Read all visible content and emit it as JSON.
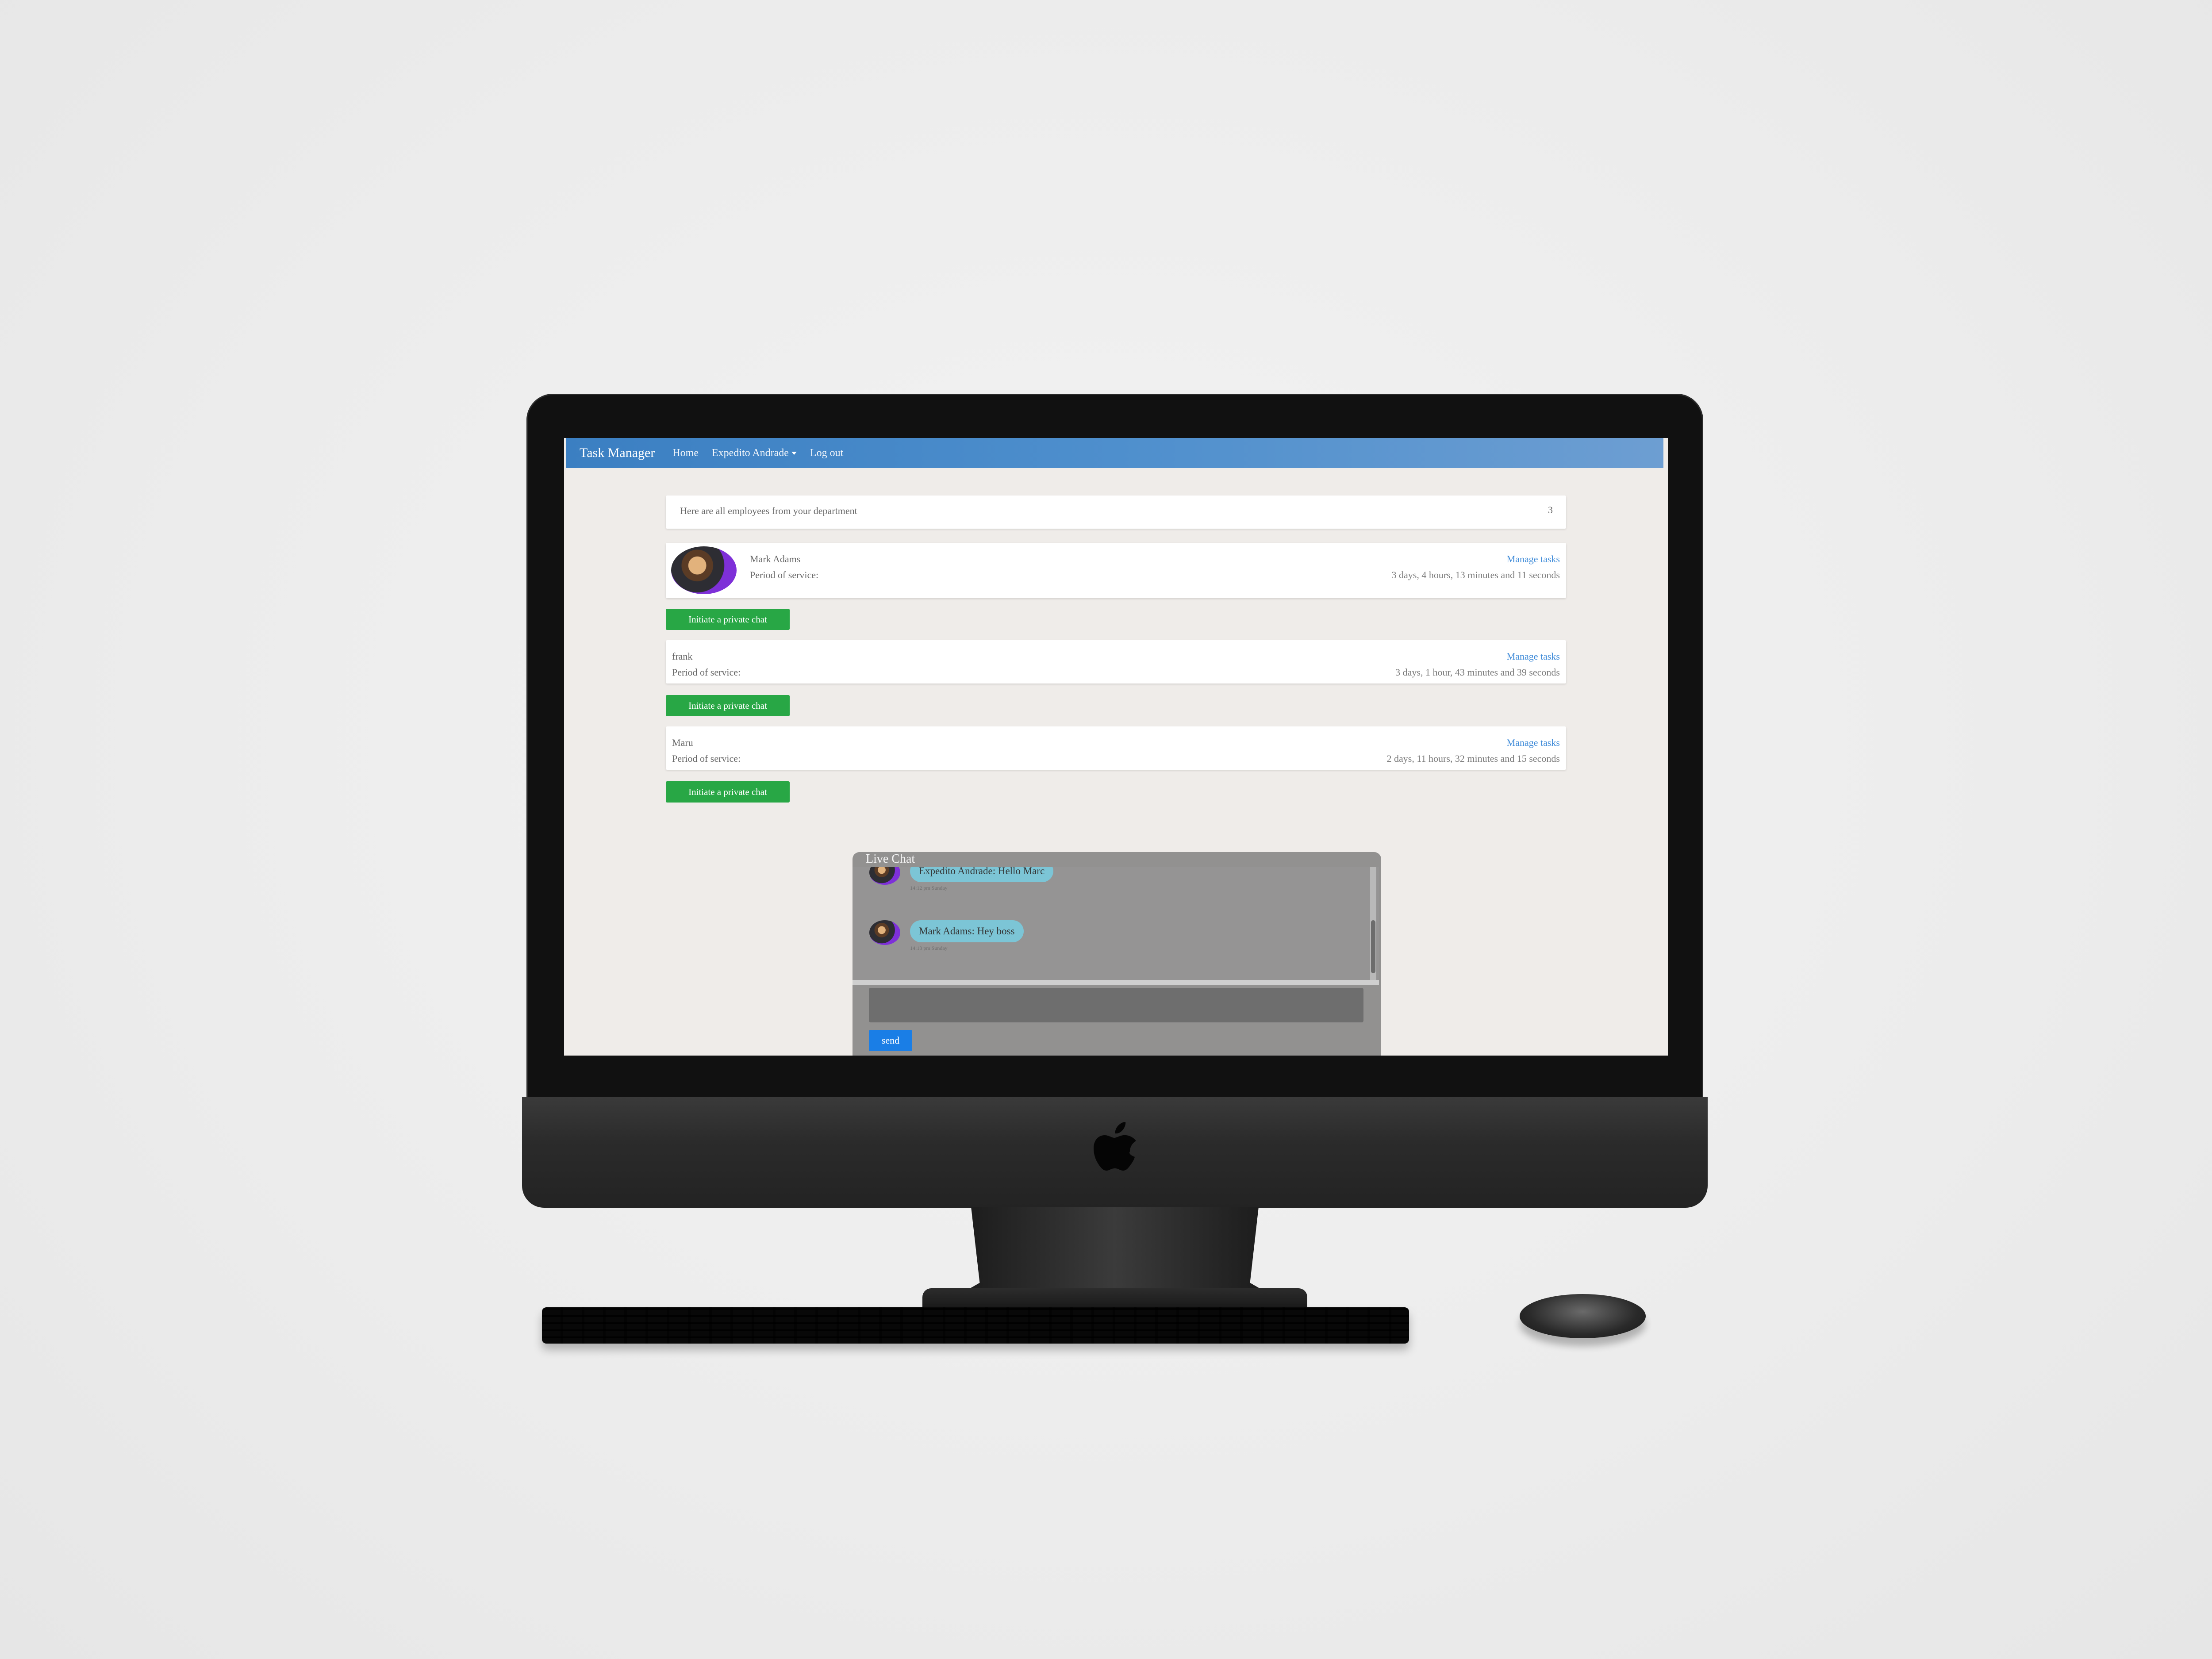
{
  "navbar": {
    "brand": "Task Manager",
    "home": "Home",
    "user": "Expedito Andrade",
    "logout": "Log out"
  },
  "department": {
    "heading": "Here are all employees from your department",
    "count": "3"
  },
  "employees": [
    {
      "name": "Mark Adams",
      "period_label": "Period of service:",
      "period": "3 days, 4 hours, 13 minutes and 11 seconds",
      "manage": "Manage tasks",
      "chat_button": "Initiate a private chat"
    },
    {
      "name": "frank",
      "period_label": "Period of service:",
      "period": "3 days, 1 hour, 43 minutes and 39 seconds",
      "manage": "Manage tasks",
      "chat_button": "Initiate a private chat"
    },
    {
      "name": "Maru",
      "period_label": "Period of service:",
      "period": "2 days, 11 hours, 32 minutes and 15 seconds",
      "manage": "Manage tasks",
      "chat_button": "Initiate a private chat"
    }
  ],
  "chat": {
    "title": "Live Chat",
    "messages": [
      {
        "text": "Expedito Andrade: Hello Marc",
        "time": "14:12 pm Sunday"
      },
      {
        "text": "Mark Adams: Hey boss",
        "time": "14:13 pm Sunday"
      }
    ],
    "send": "send"
  }
}
